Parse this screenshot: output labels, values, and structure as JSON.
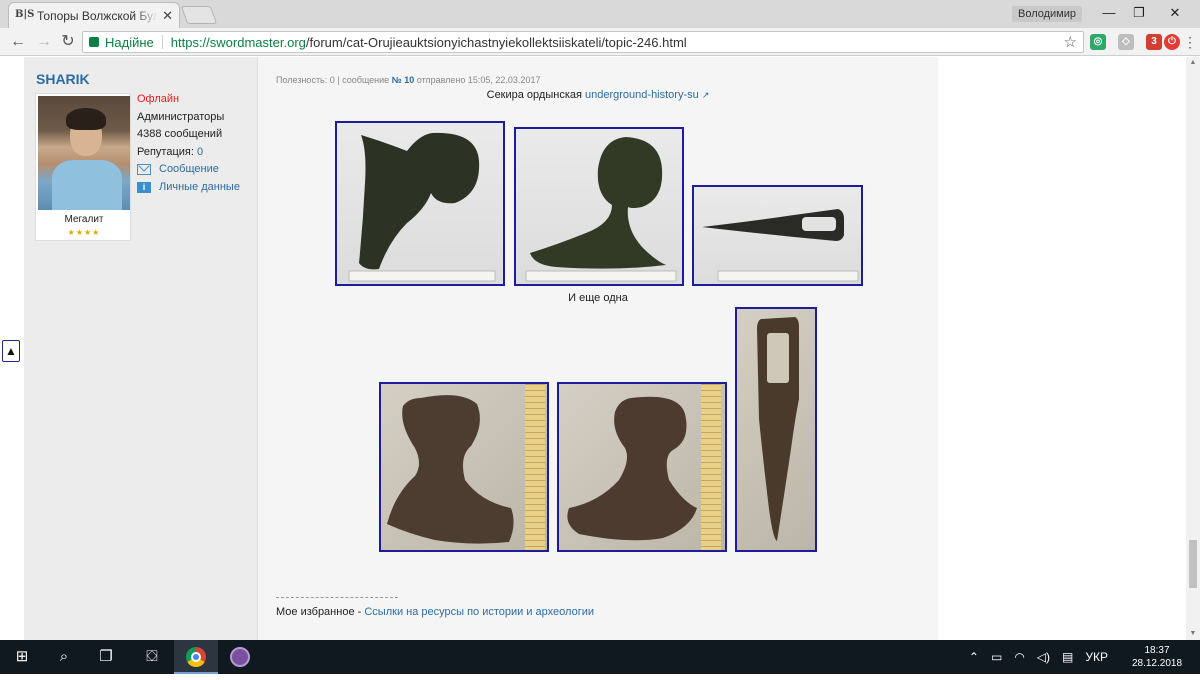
{
  "browser": {
    "tab_title": "Топоры Волжской Булга",
    "tab_close": "✕",
    "favicon_text": "B|S",
    "profile_name": "Володимир",
    "url_secure_label": "Надійне",
    "url_scheme_host": "https://swordmaster.org",
    "url_path": "/forum/cat-Orujieauktsionyichastnyiekollektsiiskateli/topic-246.html",
    "ext_badge": "3",
    "win_min": "—",
    "win_max": "❐",
    "win_close": "✕"
  },
  "post": {
    "username": "SHARIK",
    "status": "Офлайн",
    "group": "Администраторы",
    "posts_count": "4388 сообщений",
    "reputation_label": "Репутация:",
    "reputation_value": "0",
    "message_link": "Сообщение",
    "profile_link": "Личные данные",
    "rank": "Мегалит",
    "stars": "★★★★",
    "meta_prefix": "Полезность: 0 | сообщение",
    "meta_number": "№ 10",
    "meta_suffix": "отправлено 15:05, 22.03.2017",
    "caption1_text": "Секира ордынская",
    "caption1_link": "underground-history-su",
    "caption2_text": "И еще одна",
    "signature_prefix": "Мое избранное -",
    "signature_link": "Ссылки на ресурсы по истории и археологии"
  },
  "taskbar": {
    "language": "УКР",
    "time": "18:37",
    "date": "28.12.2018"
  },
  "colors": {
    "link": "#2b6ca3",
    "offline": "#e02020",
    "photo_border": "#1c1c9c"
  }
}
